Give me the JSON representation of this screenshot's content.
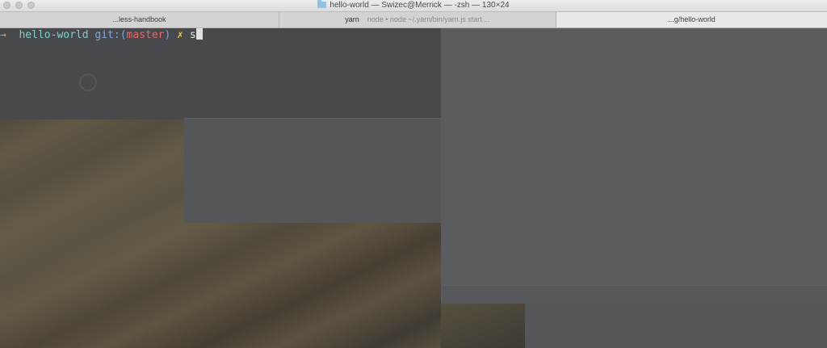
{
  "window": {
    "title": "hello-world — Swizec@Merrick — -zsh — 130×24"
  },
  "tabs": [
    {
      "label": "...less-handbook"
    },
    {
      "label": "yarn",
      "command": "node • node ~/.yarn/bin/yarn.js start ..."
    },
    {
      "label": "...g/hello-world"
    }
  ],
  "terminal": {
    "arrow": "→",
    "directory": "hello-world",
    "git_prefix": "git:(",
    "branch": "master",
    "git_suffix": ")",
    "dirty_marker": "✗",
    "typed_input": "s"
  },
  "colors": {
    "arrow": "#e0a63f",
    "directory": "#7fd0c8",
    "git": "#7fa3e2",
    "branch": "#e06a6a",
    "dirty": "#f0c842",
    "background": "#4a4c51"
  }
}
